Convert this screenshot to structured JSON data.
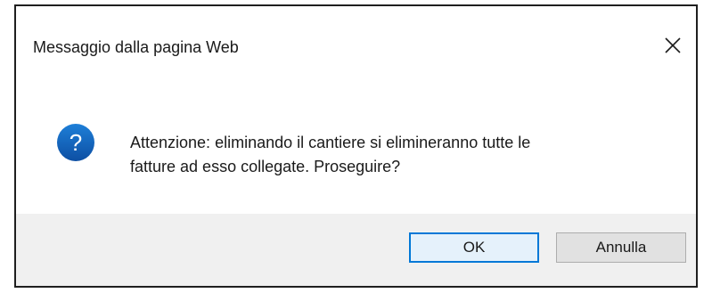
{
  "dialog": {
    "title": "Messaggio dalla pagina Web",
    "message": "Attenzione: eliminando il cantiere si elimineranno tutte le\nfatture ad esso collegate. Proseguire?",
    "icon": "question-icon",
    "close_icon": "close-icon",
    "buttons": {
      "ok_label": "OK",
      "cancel_label": "Annulla"
    }
  },
  "colors": {
    "icon_blue": "#1565c0",
    "default_button_border": "#0078d7",
    "footer_bg": "#f0f0f0"
  }
}
